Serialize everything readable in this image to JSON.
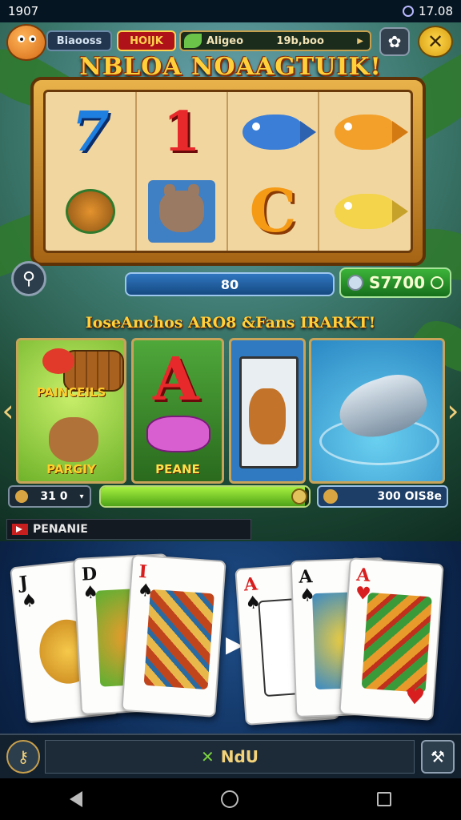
{
  "status_bar": {
    "time": "1907",
    "battery_text": "17.08"
  },
  "hud": {
    "player_name": "Biaooss",
    "hot_label": "HOIJK",
    "currency_label": "Aligeo",
    "currency_value": "19b,boo"
  },
  "title": "NBLOA NOAAGTUIK!",
  "slot": {
    "reels": [
      {
        "kind": "seven",
        "text": "7"
      },
      {
        "kind": "one",
        "text": "1"
      },
      {
        "kind": "fish-blue",
        "text": ""
      },
      {
        "kind": "fish-orange",
        "text": ""
      },
      {
        "kind": "turtle",
        "text": ""
      },
      {
        "kind": "critter",
        "text": ""
      },
      {
        "kind": "letter-c",
        "text": "C"
      },
      {
        "kind": "fish-yellow",
        "text": ""
      }
    ],
    "bet_value": "80",
    "win_value": "S7700"
  },
  "bonus": {
    "title": "IoseAnchos ARO8 &Fans IRARKT!",
    "panel1_top": "PAINCEILS",
    "panel1_bottom": "PARGIY",
    "panel2_letter": "A",
    "panel2_label": "PEANE",
    "count_value": "31 0",
    "progress": 0.98,
    "reward_value": "300 OIS8e"
  },
  "section_tag": "PENANIE",
  "cards": {
    "left_hand": [
      {
        "rank": "J",
        "suit": "♠",
        "color": "black"
      },
      {
        "rank": "D",
        "suit": "♠",
        "color": "black"
      },
      {
        "rank": "I",
        "suit": "♠",
        "color": "red"
      }
    ],
    "right_hand": [
      {
        "rank": "A",
        "suit": "♠",
        "color": "red"
      },
      {
        "rank": "A",
        "suit": "♠",
        "color": "black"
      },
      {
        "rank": "A",
        "suit": "♥",
        "color": "red"
      }
    ]
  },
  "bottom_bar": {
    "main_label": "NdU",
    "main_icon": "✕"
  },
  "colors": {
    "gold": "#ffd03a",
    "accent_green": "#3cb43a",
    "accent_blue": "#2f76c0"
  }
}
